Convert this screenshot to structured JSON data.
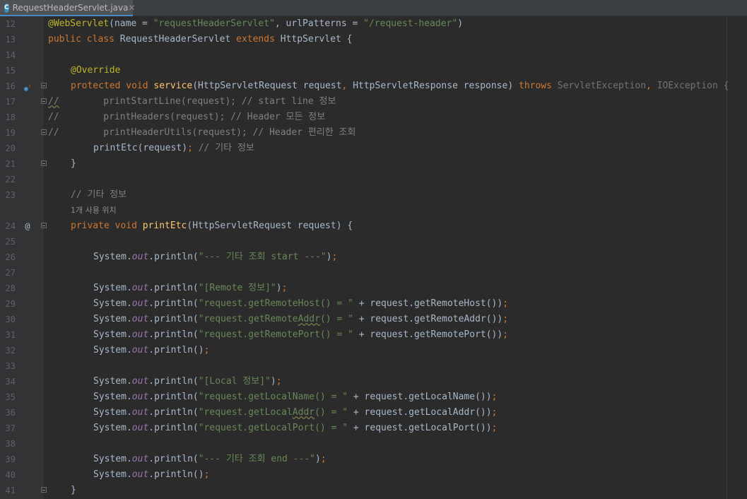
{
  "tab": {
    "icon_letter": "C",
    "title": "RequestHeaderServlet.java"
  },
  "gutter": {
    "numbers": [
      "12",
      "13",
      "14",
      "15",
      "16",
      "17",
      "18",
      "19",
      "20",
      "21",
      "22",
      "23",
      "24",
      "25",
      "26",
      "27",
      "28",
      "29",
      "30",
      "31",
      "32",
      "33",
      "34",
      "35",
      "36",
      "37",
      "38",
      "39",
      "40",
      "41"
    ],
    "usage_hint": "1개 사용 위치"
  },
  "code": {
    "l12": {
      "a": "@WebServlet",
      "b": "(name = ",
      "c": "\"requestHeaderServlet\"",
      "d": ", urlPatterns = ",
      "e": "\"/request-header\"",
      "f": ")"
    },
    "l13": {
      "a": "public class ",
      "b": "RequestHeaderServlet ",
      "c": "extends ",
      "d": "HttpServlet {"
    },
    "l15": {
      "a": "@Override"
    },
    "l16": {
      "a": "protected void ",
      "b": "service",
      "c": "(HttpServletRequest request",
      "d": ", ",
      "e": "HttpServletResponse response) ",
      "f": "throws ",
      "g": "ServletException",
      "h": ", ",
      "i": "IOException {"
    },
    "l17": {
      "a": "//",
      "b": "        printStartLine(request); // start line 정보"
    },
    "l18": {
      "a": "//        printHeaders(request); // Header 모든 정보"
    },
    "l19": {
      "a": "//        printHeaderUtils(request); // Header 편리한 조회"
    },
    "l20": {
      "a": "printEtc(request)",
      "b": ";",
      "c": " // 기타 정보"
    },
    "l21": {
      "a": "}"
    },
    "l23": {
      "a": "// 기타 정보"
    },
    "l24": {
      "a": "private void ",
      "b": "printEtc",
      "c": "(HttpServletRequest request) {"
    },
    "l26": {
      "a": "System.",
      "b": "out",
      "c": ".println(",
      "d": "\"--- 기타 조회 start ---\"",
      "e": ")",
      "f": ";"
    },
    "l28": {
      "a": "System.",
      "b": "out",
      "c": ".println(",
      "d": "\"[Remote 정보]\"",
      "e": ")",
      "f": ";"
    },
    "l29": {
      "a": "System.",
      "b": "out",
      "c": ".println(",
      "d": "\"request.getRemoteHost() = \"",
      "e": " + request.getRemoteHost())",
      "f": ";"
    },
    "l30": {
      "a": "System.",
      "b": "out",
      "c": ".println(",
      "d1": "\"request.getRemote",
      "d2": "Addr",
      "d3": "() = \"",
      "e": " + request.getRemoteAddr())",
      "f": ";"
    },
    "l31": {
      "a": "System.",
      "b": "out",
      "c": ".println(",
      "d": "\"request.getRemotePort() = \"",
      "e": " + request.getRemotePort())",
      "f": ";"
    },
    "l32": {
      "a": "System.",
      "b": "out",
      "c": ".println()",
      "f": ";"
    },
    "l34": {
      "a": "System.",
      "b": "out",
      "c": ".println(",
      "d": "\"[Local 정보]\"",
      "e": ")",
      "f": ";"
    },
    "l35": {
      "a": "System.",
      "b": "out",
      "c": ".println(",
      "d": "\"request.getLocalName() = \"",
      "e": " + request.getLocalName())",
      "f": ";"
    },
    "l36": {
      "a": "System.",
      "b": "out",
      "c": ".println(",
      "d1": "\"request.getLocal",
      "d2": "Addr",
      "d3": "() = \"",
      "e": " + request.getLocalAddr())",
      "f": ";"
    },
    "l37": {
      "a": "System.",
      "b": "out",
      "c": ".println(",
      "d": "\"request.getLocalPort() = \"",
      "e": " + request.getLocalPort())",
      "f": ";"
    },
    "l39": {
      "a": "System.",
      "b": "out",
      "c": ".println(",
      "d": "\"--- 기타 조회 end ---\"",
      "e": ")",
      "f": ";"
    },
    "l40": {
      "a": "System.",
      "b": "out",
      "c": ".println()",
      "f": ";"
    },
    "l41": {
      "a": "}"
    }
  },
  "colors": {
    "background": "#2b2b2b",
    "keyword": "#cc7832",
    "annotation": "#bbb529",
    "string": "#6a8759",
    "comment": "#808080",
    "method": "#ffc66d",
    "field": "#9876aa"
  },
  "icons": {
    "file": "java-class-icon",
    "override": "override-method-icon",
    "implemented": "at-sign-icon",
    "fold": "fold-marker-icon"
  }
}
